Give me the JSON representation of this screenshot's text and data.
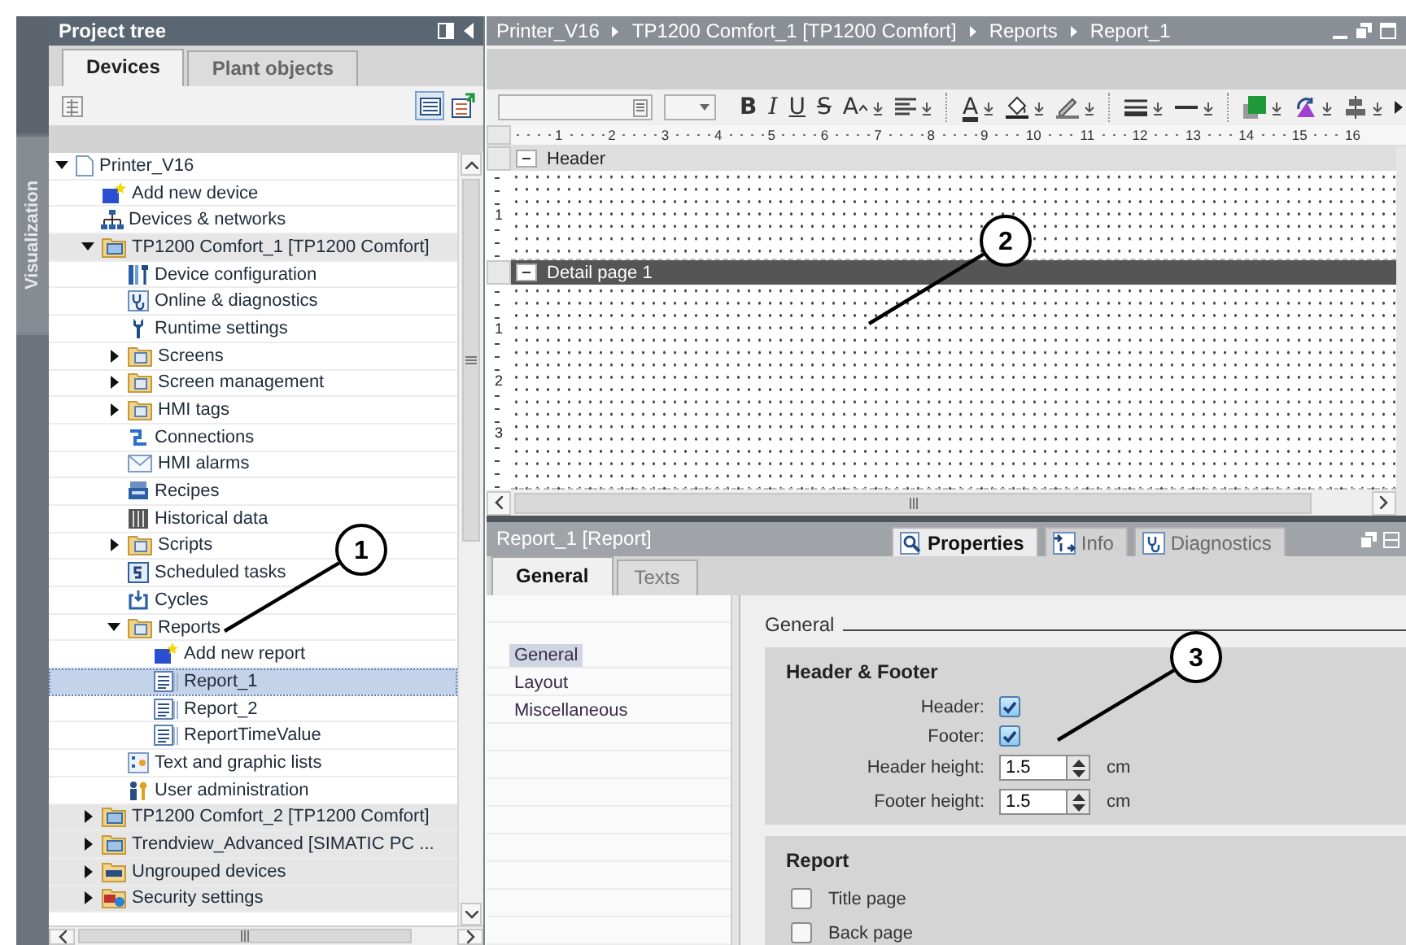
{
  "side_strip": {
    "tab": "Visualization"
  },
  "project_tree": {
    "title": "Project tree",
    "tabs": [
      {
        "label": "Devices",
        "selected": true
      },
      {
        "label": "Plant objects",
        "selected": false
      }
    ],
    "items": [
      {
        "kind": "project",
        "label": "Printer_V16",
        "expanded": true,
        "selected": false,
        "children": [
          {
            "kind": "add",
            "label": "Add new device",
            "selected": false
          },
          {
            "kind": "network",
            "label": "Devices & networks",
            "selected": false
          },
          {
            "kind": "device",
            "label": "TP1200 Comfort_1 [TP1200 Comfort]",
            "expanded": true,
            "selected": false,
            "children": [
              {
                "kind": "config",
                "label": "Device configuration",
                "selected": false
              },
              {
                "kind": "diagnostics",
                "label": "Online & diagnostics",
                "selected": false
              },
              {
                "kind": "settings",
                "label": "Runtime settings",
                "selected": false
              },
              {
                "kind": "folder",
                "label": "Screens",
                "expanded": false,
                "selected": false
              },
              {
                "kind": "folder",
                "label": "Screen management",
                "expanded": false,
                "selected": false
              },
              {
                "kind": "folder",
                "label": "HMI tags",
                "expanded": false,
                "selected": false
              },
              {
                "kind": "connections",
                "label": "Connections",
                "selected": false
              },
              {
                "kind": "alarms",
                "label": "HMI alarms",
                "selected": false
              },
              {
                "kind": "recipes",
                "label": "Recipes",
                "selected": false
              },
              {
                "kind": "historical",
                "label": "Historical data",
                "selected": false
              },
              {
                "kind": "folder",
                "label": "Scripts",
                "expanded": false,
                "selected": false
              },
              {
                "kind": "tasks",
                "label": "Scheduled tasks",
                "selected": false
              },
              {
                "kind": "cycles",
                "label": "Cycles",
                "selected": false
              },
              {
                "kind": "folder",
                "label": "Reports",
                "expanded": true,
                "selected": false,
                "children": [
                  {
                    "kind": "add",
                    "label": "Add new report",
                    "selected": false
                  },
                  {
                    "kind": "report",
                    "label": "Report_1",
                    "selected": true
                  },
                  {
                    "kind": "report",
                    "label": "Report_2",
                    "selected": false
                  },
                  {
                    "kind": "report",
                    "label": "ReportTimeValue",
                    "selected": false
                  }
                ]
              },
              {
                "kind": "textlists",
                "label": "Text and graphic lists",
                "selected": false
              },
              {
                "kind": "users",
                "label": "User administration",
                "selected": false
              }
            ]
          },
          {
            "kind": "device",
            "label": "TP1200 Comfort_2 [TP1200 Comfort]",
            "expanded": false,
            "selected": false
          },
          {
            "kind": "device",
            "label": "Trendview_Advanced [SIMATIC PC ...",
            "expanded": false,
            "selected": false
          },
          {
            "kind": "ungrouped",
            "label": "Ungrouped devices",
            "expanded": false,
            "selected": false
          },
          {
            "kind": "security",
            "label": "Security settings",
            "expanded": false,
            "selected": false
          }
        ]
      }
    ]
  },
  "editor": {
    "breadcrumb": [
      "Printer_V16",
      "TP1200 Comfort_1 [TP1200 Comfort]",
      "Reports",
      "Report_1"
    ],
    "format_toolbar": [
      {
        "kind": "font-name"
      },
      {
        "kind": "font-size"
      },
      {
        "kind": "bold",
        "label": "B"
      },
      {
        "kind": "italic",
        "label": "I"
      },
      {
        "kind": "underline",
        "label": "U"
      },
      {
        "kind": "strike",
        "label": "S"
      },
      {
        "kind": "grow",
        "label": "A"
      },
      {
        "kind": "align"
      },
      {
        "kind": "separator"
      },
      {
        "kind": "font-color",
        "label": "A"
      },
      {
        "kind": "fill"
      },
      {
        "kind": "pen"
      },
      {
        "kind": "separator"
      },
      {
        "kind": "line-width"
      },
      {
        "kind": "line-style"
      },
      {
        "kind": "separator"
      },
      {
        "kind": "color"
      },
      {
        "kind": "rotate"
      },
      {
        "kind": "arrange"
      },
      {
        "kind": "more"
      }
    ],
    "ruler": [
      "1",
      "2",
      "3",
      "4",
      "5",
      "6",
      "7",
      "8",
      "9",
      "10",
      "11",
      "12",
      "13",
      "14",
      "15",
      "16"
    ],
    "sections": [
      {
        "title": "Header",
        "selected": false,
        "ruler": [
          "1"
        ]
      },
      {
        "title": "Detail page 1",
        "selected": true,
        "ruler": [
          "1",
          "2",
          "3"
        ]
      }
    ]
  },
  "inspector": {
    "title": "Report_1 [Report]",
    "tabs": [
      {
        "kind": "properties",
        "label": "Properties",
        "selected": true
      },
      {
        "kind": "info",
        "label": "Info",
        "selected": false
      },
      {
        "kind": "diagnostics",
        "label": "Diagnostics",
        "selected": false
      }
    ],
    "subtabs": [
      {
        "label": "General",
        "selected": true
      },
      {
        "label": "Texts",
        "selected": false
      }
    ],
    "nav": [
      {
        "label": "General",
        "selected": true
      },
      {
        "label": "Layout",
        "selected": false
      },
      {
        "label": "Miscellaneous",
        "selected": false
      }
    ],
    "heading": "General",
    "groups": [
      {
        "title": "Header & Footer",
        "fields": [
          {
            "kind": "checkbox",
            "label": "Header:",
            "checked": true
          },
          {
            "kind": "checkbox",
            "label": "Footer:",
            "checked": true
          },
          {
            "kind": "spinner",
            "label": "Header height:",
            "value": "1.5",
            "unit": "cm"
          },
          {
            "kind": "spinner",
            "label": "Footer height:",
            "value": "1.5",
            "unit": "cm"
          }
        ]
      },
      {
        "title": "Report",
        "fields": [
          {
            "kind": "option",
            "label": "Title page",
            "checked": false
          },
          {
            "kind": "option",
            "label": "Back page",
            "checked": false
          }
        ]
      }
    ]
  },
  "callouts": [
    {
      "label": "1"
    },
    {
      "label": "2"
    },
    {
      "label": "3"
    }
  ]
}
